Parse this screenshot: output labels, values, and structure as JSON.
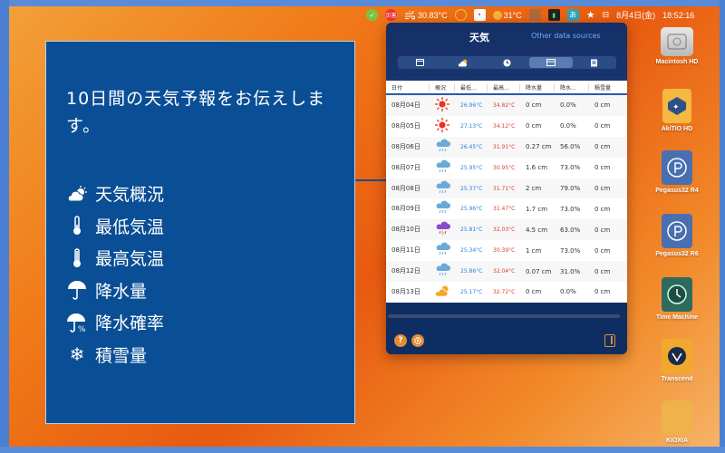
{
  "menubar": {
    "weather_temp": "30.83°C",
    "temp2": "31°C",
    "date": "8月4日(金)",
    "time": "18:52:16",
    "lang": "あ",
    "badge": "災害"
  },
  "info_panel": {
    "heading": "10日間の天気予報をお伝えします。",
    "features": [
      {
        "icon": "partly-cloudy-icon",
        "label": "天気概況"
      },
      {
        "icon": "thermometer-low-icon",
        "label": "最低気温"
      },
      {
        "icon": "thermometer-high-icon",
        "label": "最高気温"
      },
      {
        "icon": "umbrella-icon",
        "label": "降水量"
      },
      {
        "icon": "umbrella-percent-icon",
        "label": "降水確率"
      },
      {
        "icon": "snowflake-icon",
        "label": "積雪量"
      }
    ]
  },
  "popover": {
    "title": "天気",
    "other_sources": "Other data sources",
    "headers": [
      "日付",
      "概況",
      "最低…",
      "最高…",
      "降水量",
      "降水…",
      "積雪量"
    ],
    "rows": [
      {
        "date": "08月04日",
        "icon": "sun",
        "low": "26.96°C",
        "high": "34.82°C",
        "precip": "0 cm",
        "prob": "0.0%",
        "snow": "0 cm"
      },
      {
        "date": "08月05日",
        "icon": "sun",
        "low": "27.13°C",
        "high": "34.12°C",
        "precip": "0 cm",
        "prob": "0.0%",
        "snow": "0 cm"
      },
      {
        "date": "08月06日",
        "icon": "rain",
        "low": "26.45°C",
        "high": "31.91°C",
        "precip": "0.27 cm",
        "prob": "56.0%",
        "snow": "0 cm"
      },
      {
        "date": "08月07日",
        "icon": "rain",
        "low": "25.95°C",
        "high": "30.95°C",
        "precip": "1.6 cm",
        "prob": "73.0%",
        "snow": "0 cm"
      },
      {
        "date": "08月08日",
        "icon": "rain",
        "low": "25.37°C",
        "high": "31.71°C",
        "precip": "2 cm",
        "prob": "79.0%",
        "snow": "0 cm"
      },
      {
        "date": "08月09日",
        "icon": "rain",
        "low": "25.96°C",
        "high": "31.47°C",
        "precip": "1.7 cm",
        "prob": "73.0%",
        "snow": "0 cm"
      },
      {
        "date": "08月10日",
        "icon": "thunder",
        "low": "25.81°C",
        "high": "32.03°C",
        "precip": "4.5 cm",
        "prob": "63.0%",
        "snow": "0 cm"
      },
      {
        "date": "08月11日",
        "icon": "rain",
        "low": "25.34°C",
        "high": "30.39°C",
        "precip": "1 cm",
        "prob": "73.0%",
        "snow": "0 cm"
      },
      {
        "date": "08月12日",
        "icon": "rain",
        "low": "25.86°C",
        "high": "32.04°C",
        "precip": "0.07 cm",
        "prob": "31.0%",
        "snow": "0 cm"
      },
      {
        "date": "08月13日",
        "icon": "partly-cloudy",
        "low": "25.17°C",
        "high": "32.72°C",
        "precip": "0 cm",
        "prob": "0.0%",
        "snow": "0 cm"
      }
    ]
  },
  "desktop": [
    {
      "name": "Macintosh HD",
      "icon": "hard-drive-icon"
    },
    {
      "name": "AkiTiO HD",
      "icon": "akitio-drive-icon"
    },
    {
      "name": "Pegasus32 R4",
      "icon": "pegasus-drive-icon"
    },
    {
      "name": "Pegasus32 R6",
      "icon": "pegasus-drive-icon"
    },
    {
      "name": "Time Machine",
      "icon": "time-machine-icon"
    },
    {
      "name": "Transcend",
      "icon": "transcend-drive-icon"
    },
    {
      "name": "KIOXIA",
      "icon": "kioxia-drive-icon"
    }
  ]
}
